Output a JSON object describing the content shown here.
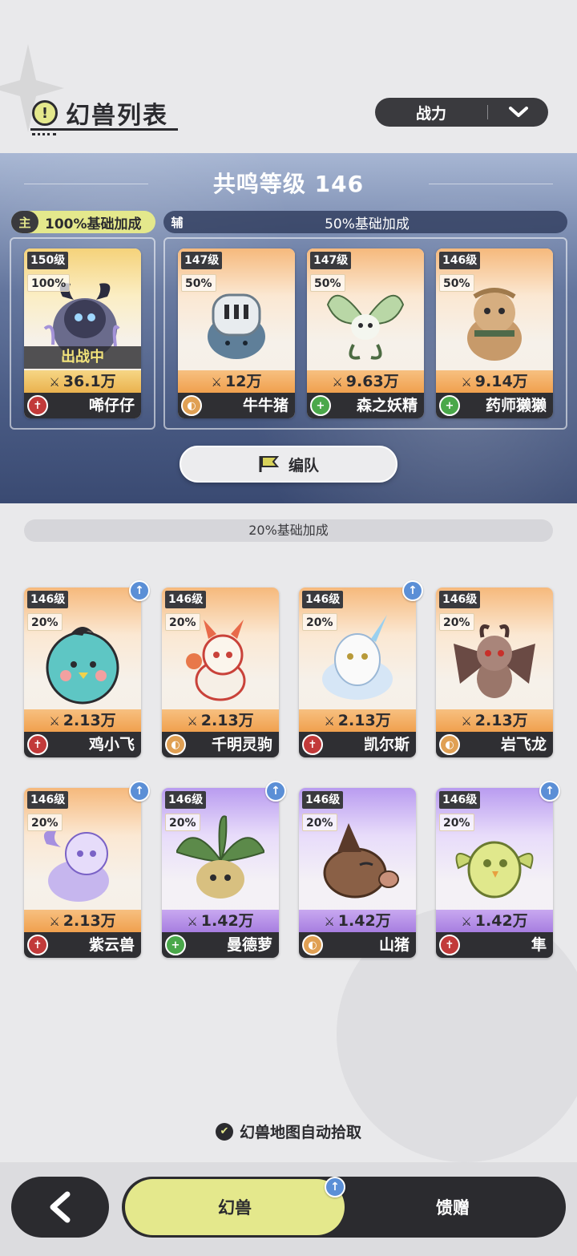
{
  "header": {
    "title": "幻兽列表",
    "title_icon": "alert-circle-icon",
    "sort_label": "战力"
  },
  "banner": {
    "resonance": "共鸣等级 146",
    "main_tag": "主",
    "main_bonus": "100%基础加成",
    "support_tag": "辅",
    "support_bonus": "50%基础加成",
    "formation_label": "编队"
  },
  "section_bonus": "20%基础加成",
  "main_card": {
    "level": "150级",
    "pct": "100%",
    "status": "出战中",
    "power": "36.1万",
    "name": "唏仔仔",
    "role": "attack",
    "theme": "yl"
  },
  "support_cards": [
    {
      "level": "147级",
      "pct": "50%",
      "power": "12万",
      "name": "牛牛猪",
      "role": "defense",
      "theme": "or"
    },
    {
      "level": "147级",
      "pct": "50%",
      "power": "9.63万",
      "name": "森之妖精",
      "role": "heal",
      "theme": "or"
    },
    {
      "level": "146级",
      "pct": "50%",
      "power": "9.14万",
      "name": "药师獭獭",
      "role": "heal",
      "theme": "or"
    }
  ],
  "cards": [
    {
      "level": "146级",
      "pct": "20%",
      "power": "2.13万",
      "name": "鸡小飞",
      "role": "attack",
      "theme": "or",
      "upgrade": true
    },
    {
      "level": "146级",
      "pct": "20%",
      "power": "2.13万",
      "name": "千明灵驹",
      "role": "defense",
      "theme": "or",
      "upgrade": false
    },
    {
      "level": "146级",
      "pct": "20%",
      "power": "2.13万",
      "name": "凯尔斯",
      "role": "attack",
      "theme": "or",
      "upgrade": true
    },
    {
      "level": "146级",
      "pct": "20%",
      "power": "2.13万",
      "name": "岩飞龙",
      "role": "defense",
      "theme": "or",
      "upgrade": false
    },
    {
      "level": "146级",
      "pct": "20%",
      "power": "2.13万",
      "name": "紫云兽",
      "role": "attack",
      "theme": "or",
      "upgrade": true
    },
    {
      "level": "146级",
      "pct": "20%",
      "power": "1.42万",
      "name": "曼德萝",
      "role": "heal",
      "theme": "pu",
      "upgrade": true
    },
    {
      "level": "146级",
      "pct": "20%",
      "power": "1.42万",
      "name": "山猪",
      "role": "defense",
      "theme": "pu",
      "upgrade": false
    },
    {
      "level": "146级",
      "pct": "20%",
      "power": "1.42万",
      "name": "隼",
      "role": "attack",
      "theme": "pu",
      "upgrade": true
    }
  ],
  "auto_pickup": "幻兽地图自动拾取",
  "nav": {
    "tab1": "幻兽",
    "tab2": "馈赠",
    "tab1_upgrade": true
  },
  "colors": {
    "accent": "#e4e88c",
    "dark": "#2b2b2f",
    "upgrade": "#5b8fd6"
  }
}
